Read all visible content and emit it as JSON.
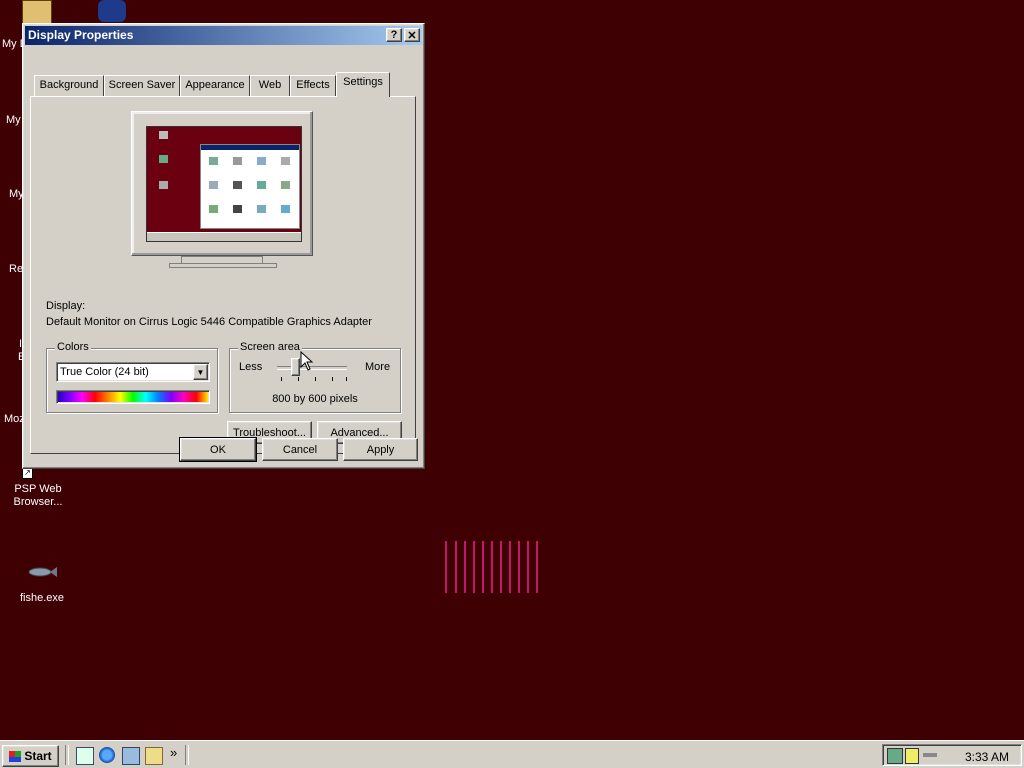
{
  "desktop": {
    "partial_labels": [
      "My D",
      "My",
      "My",
      "Re",
      "I",
      "E",
      "Moz"
    ],
    "icons": [
      {
        "label": "PSP Web Browser...",
        "icon": "shortcut-icon"
      },
      {
        "label": "fishe.exe",
        "icon": "fish-icon"
      }
    ]
  },
  "dialog": {
    "title": "Display Properties",
    "help_label": "?",
    "close_label": "✕",
    "tabs": [
      "Background",
      "Screen Saver",
      "Appearance",
      "Web",
      "Effects",
      "Settings"
    ],
    "active_tab": "Settings",
    "display_label": "Display:",
    "display_value": "Default Monitor on Cirrus Logic 5446 Compatible Graphics Adapter",
    "colors": {
      "title": "Colors",
      "selected": "True Color (24 bit)"
    },
    "screen_area": {
      "title": "Screen area",
      "less_label": "Less",
      "more_label": "More",
      "value_text": "800 by 600 pixels",
      "slider_position": 0.25
    },
    "troubleshoot_label": "Troubleshoot...",
    "advanced_label": "Advanced...",
    "ok_label": "OK",
    "cancel_label": "Cancel",
    "apply_label": "Apply"
  },
  "taskbar": {
    "start_label": "Start",
    "overflow_label": "»",
    "quick_launch": [
      "desktop-icon",
      "ie-icon",
      "outlook-icon",
      "channels-icon"
    ],
    "clock": "3:33 AM"
  },
  "colors": {
    "desktop_bg": "#3f0004",
    "title_gradient_start": "#0a246a",
    "face": "#d4d0c8"
  }
}
